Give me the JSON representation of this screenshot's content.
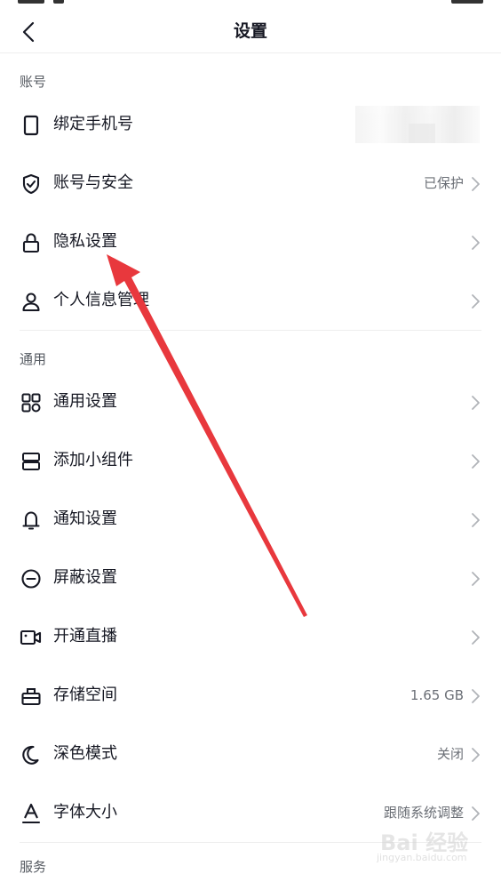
{
  "header": {
    "title": "设置"
  },
  "sections": {
    "account": "账号",
    "general": "通用",
    "services": "服务"
  },
  "rows": {
    "bind_phone": {
      "label": "绑定手机号",
      "icon": "phone-icon"
    },
    "account_security": {
      "label": "账号与安全",
      "value": "已保护",
      "icon": "shield-icon"
    },
    "privacy": {
      "label": "隐私设置",
      "icon": "lock-icon"
    },
    "personal_info": {
      "label": "个人信息管理",
      "icon": "person-icon"
    },
    "general_settings": {
      "label": "通用设置",
      "icon": "grid-icon"
    },
    "add_widget": {
      "label": "添加小组件",
      "icon": "widget-icon"
    },
    "notification": {
      "label": "通知设置",
      "icon": "bell-icon"
    },
    "block": {
      "label": "屏蔽设置",
      "icon": "minus-circle-icon"
    },
    "live": {
      "label": "开通直播",
      "icon": "video-icon"
    },
    "storage": {
      "label": "存储空间",
      "value": "1.65 GB",
      "icon": "box-icon"
    },
    "dark_mode": {
      "label": "深色模式",
      "value": "关闭",
      "icon": "moon-icon"
    },
    "font_size": {
      "label": "字体大小",
      "value": "跟随系统调整",
      "icon": "font-icon"
    }
  },
  "watermark": {
    "main": "Bai 经验",
    "sub": "jingyan.baidu.com"
  },
  "colors": {
    "annotation_arrow": "#e8383d",
    "text_primary": "#161823",
    "text_secondary": "#6b6f76"
  }
}
